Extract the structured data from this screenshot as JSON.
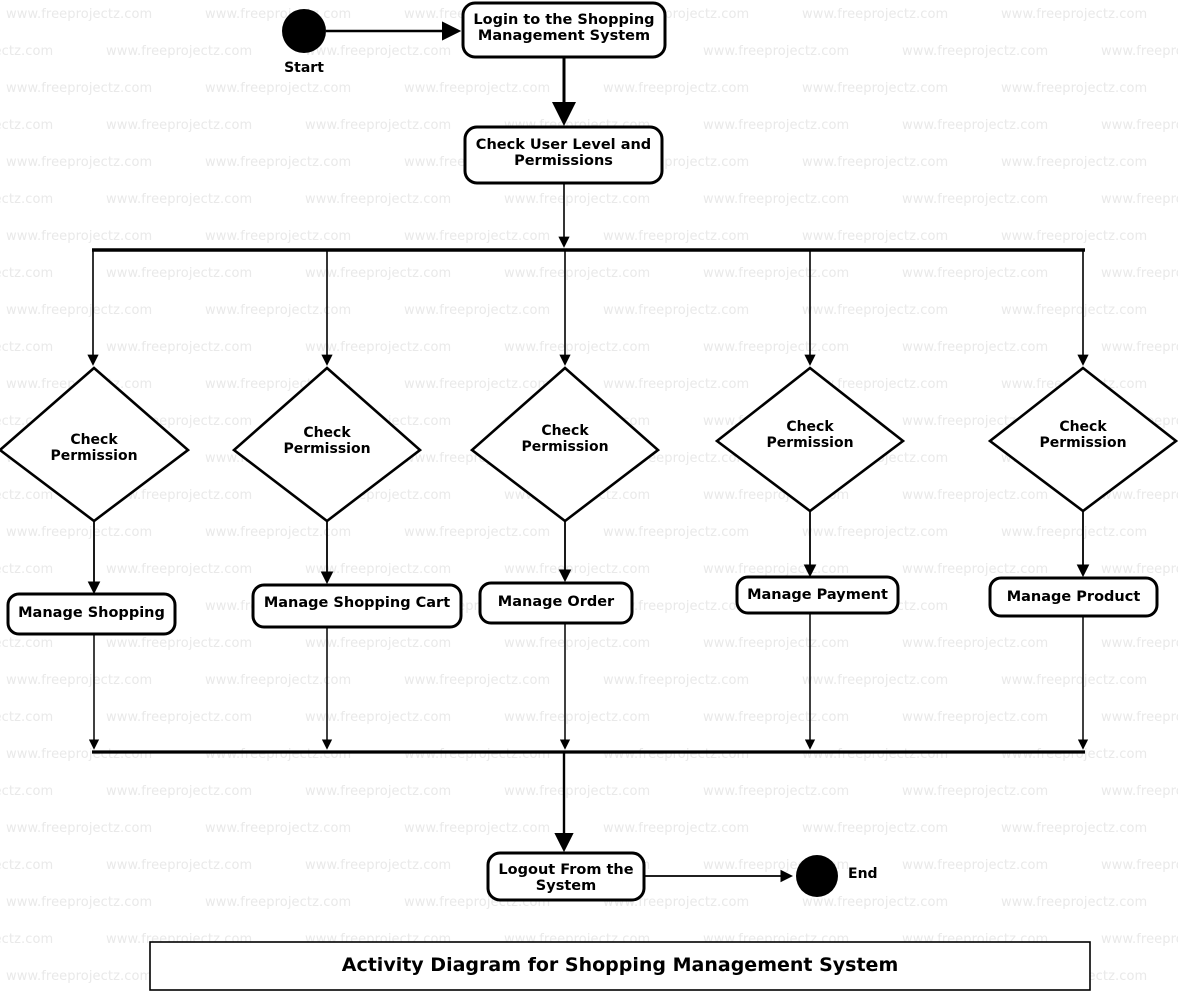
{
  "diagram": {
    "title": "Activity Diagram for Shopping Management System",
    "watermark_text": "www.freeprojectz.com",
    "colors": {
      "stroke": "#000000",
      "fill": "#ffffff",
      "watermark": "#e9e9e9"
    }
  },
  "nodes": {
    "start": {
      "label": "Start"
    },
    "end": {
      "label": "End"
    },
    "login": {
      "label": "Login to the Shopping\nManagement System",
      "line1": "Login to the Shopping",
      "line2": "Management System"
    },
    "check_user": {
      "label": "Check User Level and\nPermissions",
      "line1": "Check User Level and",
      "line2": "Permissions"
    },
    "logout": {
      "label": "Logout From the\nSystem",
      "line1": "Logout From the",
      "line2": "System"
    }
  },
  "decisions": [
    {
      "id": "check-permission-1",
      "line1": "Check",
      "line2": "Permission"
    },
    {
      "id": "check-permission-2",
      "line1": "Check",
      "line2": "Permission"
    },
    {
      "id": "check-permission-3",
      "line1": "Check",
      "line2": "Permission"
    },
    {
      "id": "check-permission-4",
      "line1": "Check",
      "line2": "Permission"
    },
    {
      "id": "check-permission-5",
      "line1": "Check",
      "line2": "Permission"
    }
  ],
  "activities": [
    {
      "id": "manage-shopping",
      "label": "Manage Shopping"
    },
    {
      "id": "manage-shopping-cart",
      "label": "Manage Shopping Cart"
    },
    {
      "id": "manage-order",
      "label": "Manage Order"
    },
    {
      "id": "manage-payment",
      "label": "Manage Payment"
    },
    {
      "id": "manage-product",
      "label": "Manage Product"
    }
  ]
}
